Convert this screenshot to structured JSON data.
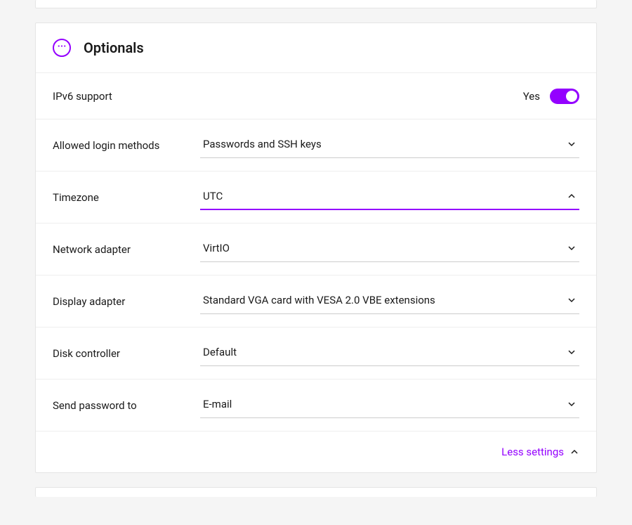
{
  "section": {
    "title": "Optionals"
  },
  "ipv6": {
    "label": "IPv6 support",
    "status": "Yes"
  },
  "fields": {
    "login_methods": {
      "label": "Allowed login methods",
      "value": "Passwords and SSH keys"
    },
    "timezone": {
      "label": "Timezone",
      "value": "UTC"
    },
    "network_adapter": {
      "label": "Network adapter",
      "value": "VirtIO"
    },
    "display_adapter": {
      "label": "Display adapter",
      "value": "Standard VGA card with VESA 2.0 VBE extensions"
    },
    "disk_controller": {
      "label": "Disk controller",
      "value": "Default"
    },
    "send_password": {
      "label": "Send password to",
      "value": "E-mail"
    }
  },
  "footer": {
    "less_settings": "Less settings"
  }
}
